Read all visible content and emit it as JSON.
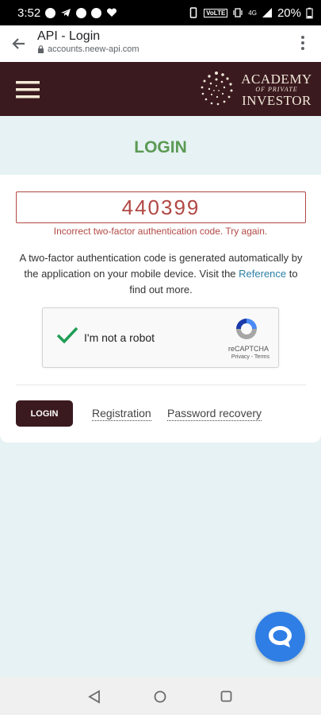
{
  "status_bar": {
    "time": "3:52",
    "battery": "20%",
    "network_badge": "VoLTE",
    "signal_label": "4G"
  },
  "browser": {
    "title": "API - Login",
    "url": "accounts.neew-api.com"
  },
  "logo": {
    "line1": "Academy",
    "line2": "of private",
    "line3": "Investor"
  },
  "login": {
    "heading": "LOGIN",
    "code_value": "440399",
    "error": "Incorrect two-factor authentication code. Try again.",
    "info_before": "A two-factor authentication code is generated automatically by the application on your mobile device. Visit the ",
    "info_link": "Reference",
    "info_after": " to find out more.",
    "login_button": "LOGIN",
    "registration_link": "Registration",
    "recovery_link": "Password recovery"
  },
  "recaptcha": {
    "label": "I'm not a robot",
    "brand": "reCAPTCHA",
    "links": "Privacy - Terms"
  },
  "colors": {
    "header_bg": "#3a1a1f",
    "heading_green": "#5b9a54",
    "error_red": "#b14844",
    "chat_blue": "#2f7ee6",
    "link_blue": "#2b7fa6"
  }
}
